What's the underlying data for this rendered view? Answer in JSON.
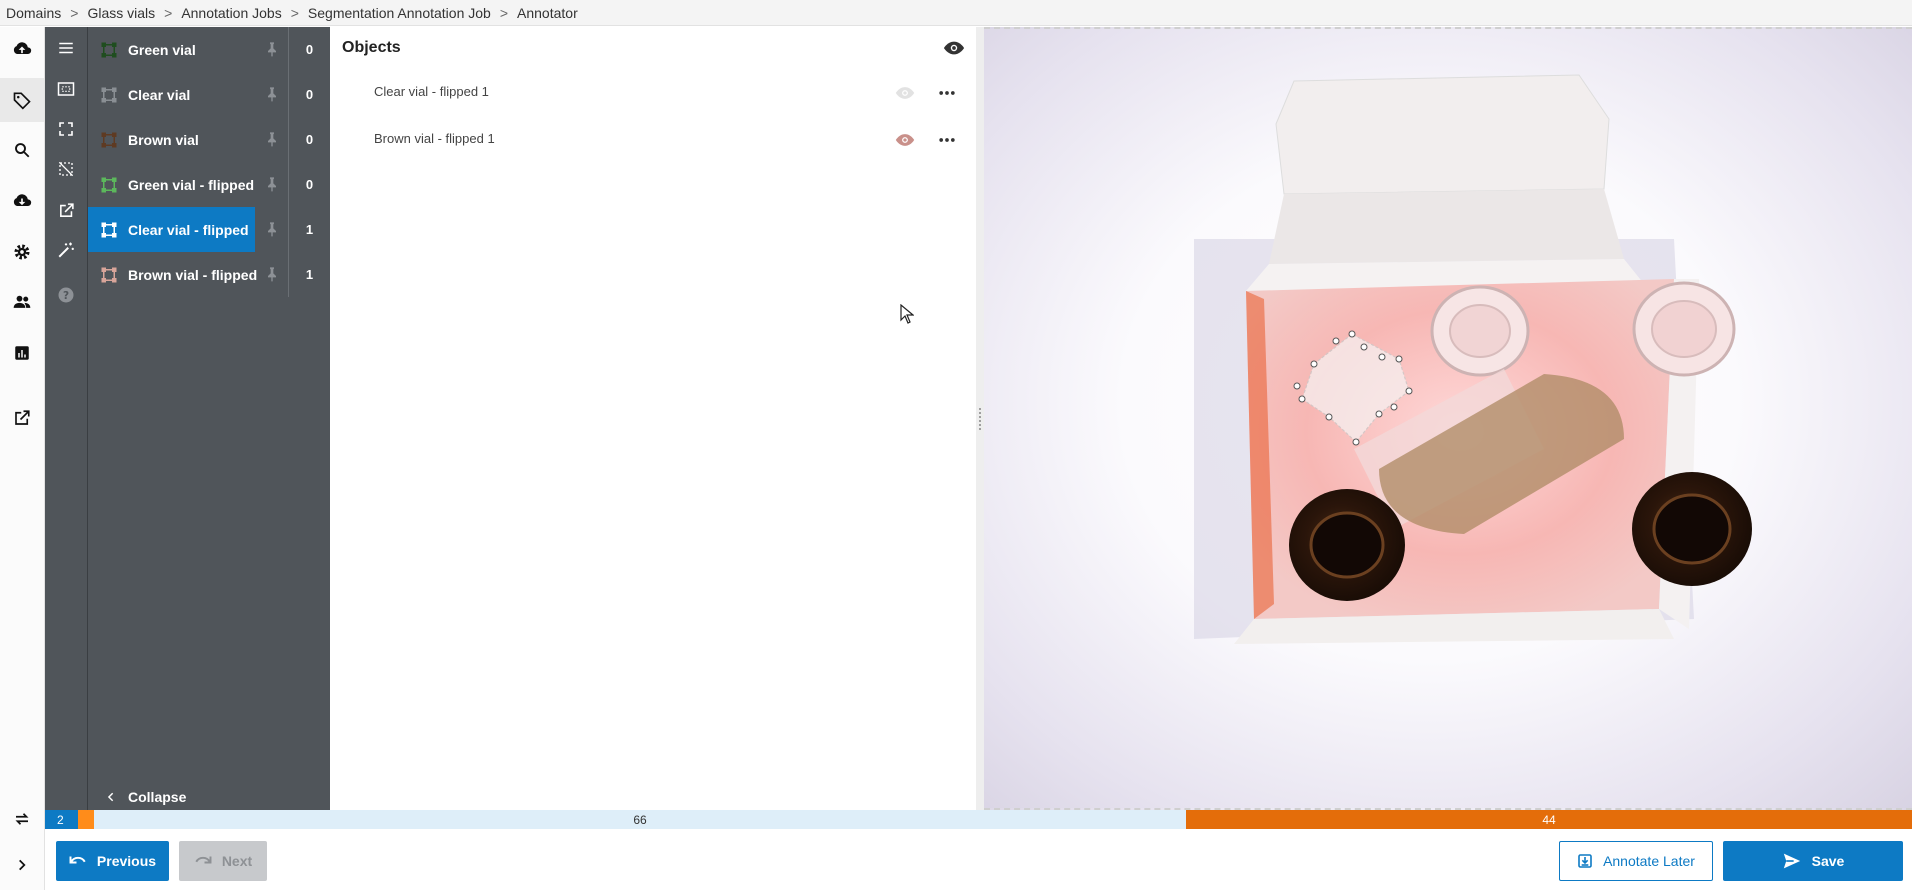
{
  "breadcrumb": [
    {
      "label": "Domains"
    },
    {
      "label": "Glass vials"
    },
    {
      "label": "Annotation Jobs"
    },
    {
      "label": "Segmentation Annotation Job"
    },
    {
      "label": "Annotator"
    }
  ],
  "breadcrumb_separator": ">",
  "rail": [
    {
      "icon": "cloud-upload-icon"
    },
    {
      "icon": "tag-icon",
      "active": true
    },
    {
      "icon": "search-icon"
    },
    {
      "icon": "cloud-download-icon"
    },
    {
      "icon": "gear-icon"
    },
    {
      "icon": "people-icon"
    },
    {
      "icon": "bar-chart-icon"
    },
    {
      "icon": "external-link-icon"
    },
    {
      "icon": "swap-icon"
    },
    {
      "icon": "chevron-right-icon"
    }
  ],
  "tools": [
    {
      "icon": "menu-icon"
    },
    {
      "icon": "box-select-icon"
    },
    {
      "icon": "fit-screen-icon"
    },
    {
      "icon": "clear-selection-icon"
    },
    {
      "icon": "open-external-icon"
    },
    {
      "icon": "magic-wand-icon"
    },
    {
      "icon": "help-icon"
    }
  ],
  "labels": [
    {
      "name": "Green vial",
      "count": "0",
      "color": "#2e7d32",
      "selected": false
    },
    {
      "name": "Clear vial",
      "count": "0",
      "color": "#8a8f94",
      "selected": false
    },
    {
      "name": "Brown vial",
      "count": "0",
      "color": "#7a4a2a",
      "selected": false
    },
    {
      "name": "Green vial - flipped",
      "count": "0",
      "color": "#5cb85c",
      "selected": false
    },
    {
      "name": "Clear vial - flipped",
      "count": "1",
      "color": "#ffffff",
      "selected": true
    },
    {
      "name": "Brown vial - flipped",
      "count": "1",
      "color": "#d9a59a",
      "selected": false
    }
  ],
  "collapse_label": "Collapse",
  "objects": {
    "title": "Objects",
    "items": [
      {
        "name": "Clear vial - flipped 1",
        "eye_color": "#dcdcdc"
      },
      {
        "name": "Brown vial - flipped 1",
        "eye_color": "#c9908a"
      }
    ]
  },
  "progress": {
    "current": "2",
    "middle": "66",
    "right": "44",
    "colors": {
      "current": "#0d7ac4",
      "marker": "#ff8c1a",
      "remaining": "#deeef9",
      "later": "#e46d0a"
    }
  },
  "footer": {
    "previous_label": "Previous",
    "next_label": "Next",
    "annotate_later_label": "Annotate Later",
    "save_label": "Save"
  },
  "colors": {
    "accent": "#0d7ac4",
    "sidebar": "#50555a",
    "orange": "#e46d0a"
  }
}
